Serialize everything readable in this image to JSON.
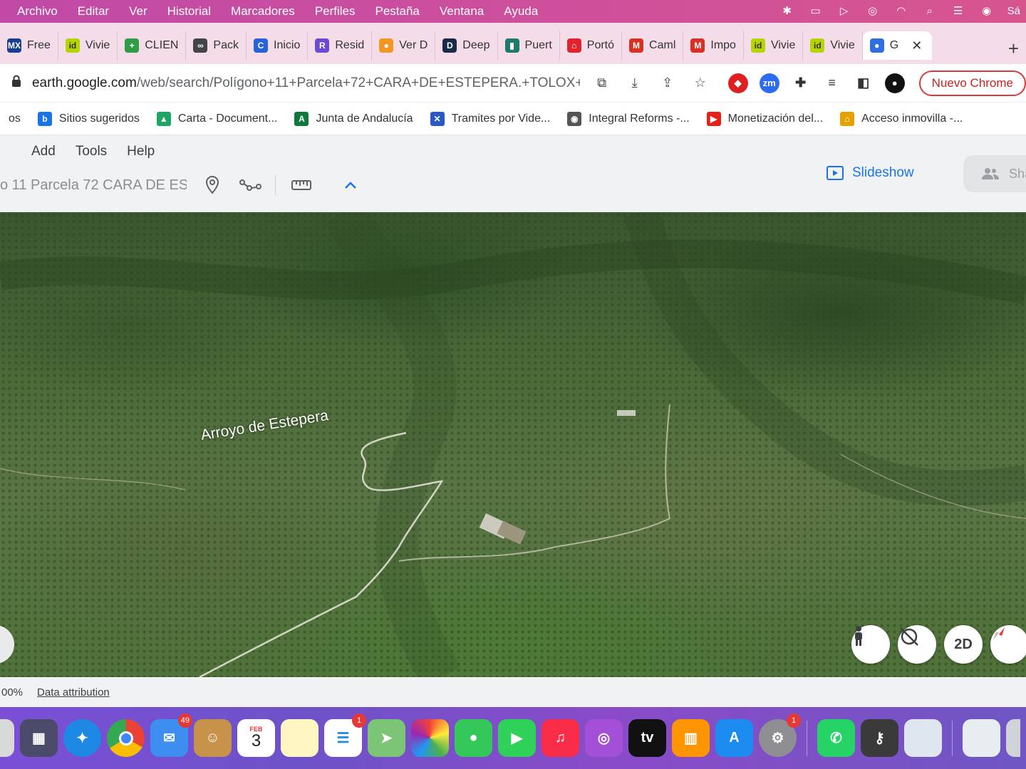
{
  "menubar": {
    "items": [
      "Archivo",
      "Editar",
      "Ver",
      "Historial",
      "Marcadores",
      "Perfiles",
      "Pestaña",
      "Ventana",
      "Ayuda"
    ],
    "right_label": "Sá"
  },
  "tabs": [
    {
      "label": "Free",
      "fav": "MX",
      "color": "#1b3f8f"
    },
    {
      "label": "Vivie",
      "fav": "id",
      "color": "#b6d400"
    },
    {
      "label": "CLIEN",
      "fav": "+",
      "color": "#2e9d46"
    },
    {
      "label": "Pack",
      "fav": "∞",
      "color": "#444444"
    },
    {
      "label": "Inicio",
      "fav": "C",
      "color": "#2a63d6"
    },
    {
      "label": "Resid",
      "fav": "R",
      "color": "#6b4bd1"
    },
    {
      "label": "Ver D",
      "fav": "●",
      "color": "#f19722"
    },
    {
      "label": "Deep",
      "fav": "D",
      "color": "#1a2a4a"
    },
    {
      "label": "Puert",
      "fav": "▮",
      "color": "#1f7a6b"
    },
    {
      "label": "Portó",
      "fav": "⌂",
      "color": "#e0242e"
    },
    {
      "label": "Caml",
      "fav": "M",
      "color": "#d93025"
    },
    {
      "label": "Impo",
      "fav": "M",
      "color": "#d93025"
    },
    {
      "label": "Vivie",
      "fav": "id",
      "color": "#b6d400"
    },
    {
      "label": "Vivie",
      "fav": "id",
      "color": "#b6d400"
    },
    {
      "label": "G",
      "fav": "●",
      "color": "#2f6fe0",
      "active": true
    }
  ],
  "omnibar": {
    "host": "earth.google.com",
    "path": "/web/search/Polígono+11+Parcela+72+CARA+DE+ESTEPERA.+TOLOX+...",
    "nuevo_chrome": "Nuevo Chrome"
  },
  "bookmarks": [
    {
      "label": "os",
      "fav": "",
      "color": "#ffffff"
    },
    {
      "label": "Sitios sugeridos",
      "fav": "b",
      "color": "#1a73e8"
    },
    {
      "label": "Carta - Document...",
      "fav": "▲",
      "color": "#1fa463"
    },
    {
      "label": "Junta de Andalucía",
      "fav": "A",
      "color": "#0b7a3b"
    },
    {
      "label": "Tramites por Vide...",
      "fav": "✕",
      "color": "#2b59c3"
    },
    {
      "label": "Integral Reforms -...",
      "fav": "◉",
      "color": "#555555"
    },
    {
      "label": "Monetización del...",
      "fav": "▶",
      "color": "#e62117"
    },
    {
      "label": "Acceso inmovilla -...",
      "fav": "⌂",
      "color": "#e6a100"
    }
  ],
  "earth": {
    "menu": [
      "Add",
      "Tools",
      "Help"
    ],
    "search_text": "o 11 Parcela 72 CARA DE ES",
    "slideshow": "Slideshow",
    "share": "Sha"
  },
  "map": {
    "place_label": "Arroyo de Estepera",
    "btn_2d": "2D"
  },
  "footer": {
    "zoom": "00%",
    "data_attribution": "Data attribution"
  },
  "dock": {
    "calendar_month": "FEB",
    "calendar_day": "3",
    "mail_badge": "49",
    "reminders_badge": "1",
    "settings_badge": "1"
  },
  "colors": {
    "menubar": "#cc4f9e",
    "accent_blue": "#1a73e8",
    "nuevo_red": "#c5221f"
  }
}
